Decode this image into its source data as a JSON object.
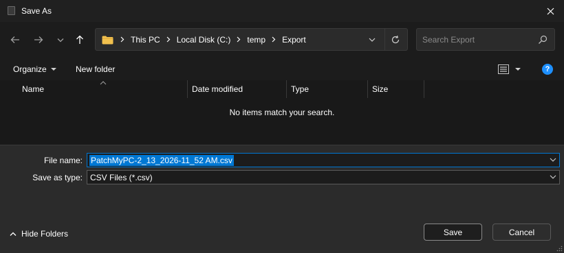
{
  "window": {
    "title": "Save As"
  },
  "address": {
    "crumbs": [
      "This PC",
      "Local Disk (C:)",
      "temp",
      "Export"
    ]
  },
  "search": {
    "placeholder": "Search Export"
  },
  "toolbar": {
    "organize_label": "Organize",
    "new_folder_label": "New folder",
    "help_label": "?"
  },
  "file_list": {
    "columns": [
      "Name",
      "Date modified",
      "Type",
      "Size"
    ],
    "empty_message": "No items match your search."
  },
  "form": {
    "file_name_label": "File name:",
    "file_name_value": "PatchMyPC-2_13_2026-11_52 AM.csv",
    "save_as_type_label": "Save as type:",
    "save_as_type_value": "CSV Files (*.csv)"
  },
  "footer": {
    "hide_folders_label": "Hide Folders",
    "save_label": "Save",
    "cancel_label": "Cancel"
  },
  "colors": {
    "accent": "#0078d4",
    "help_badge": "#1e90ff",
    "folder": "#f2c14e"
  },
  "icons": [
    "app-icon",
    "close-icon",
    "back-arrow-icon",
    "forward-arrow-icon",
    "recent-locations-icon",
    "up-arrow-icon",
    "folder-icon",
    "chevron-right-icon",
    "chevron-down-icon",
    "refresh-icon",
    "search-icon",
    "view-options-icon",
    "help-icon",
    "sort-arrow-icon",
    "chevron-up-icon",
    "resize-grip-icon"
  ]
}
